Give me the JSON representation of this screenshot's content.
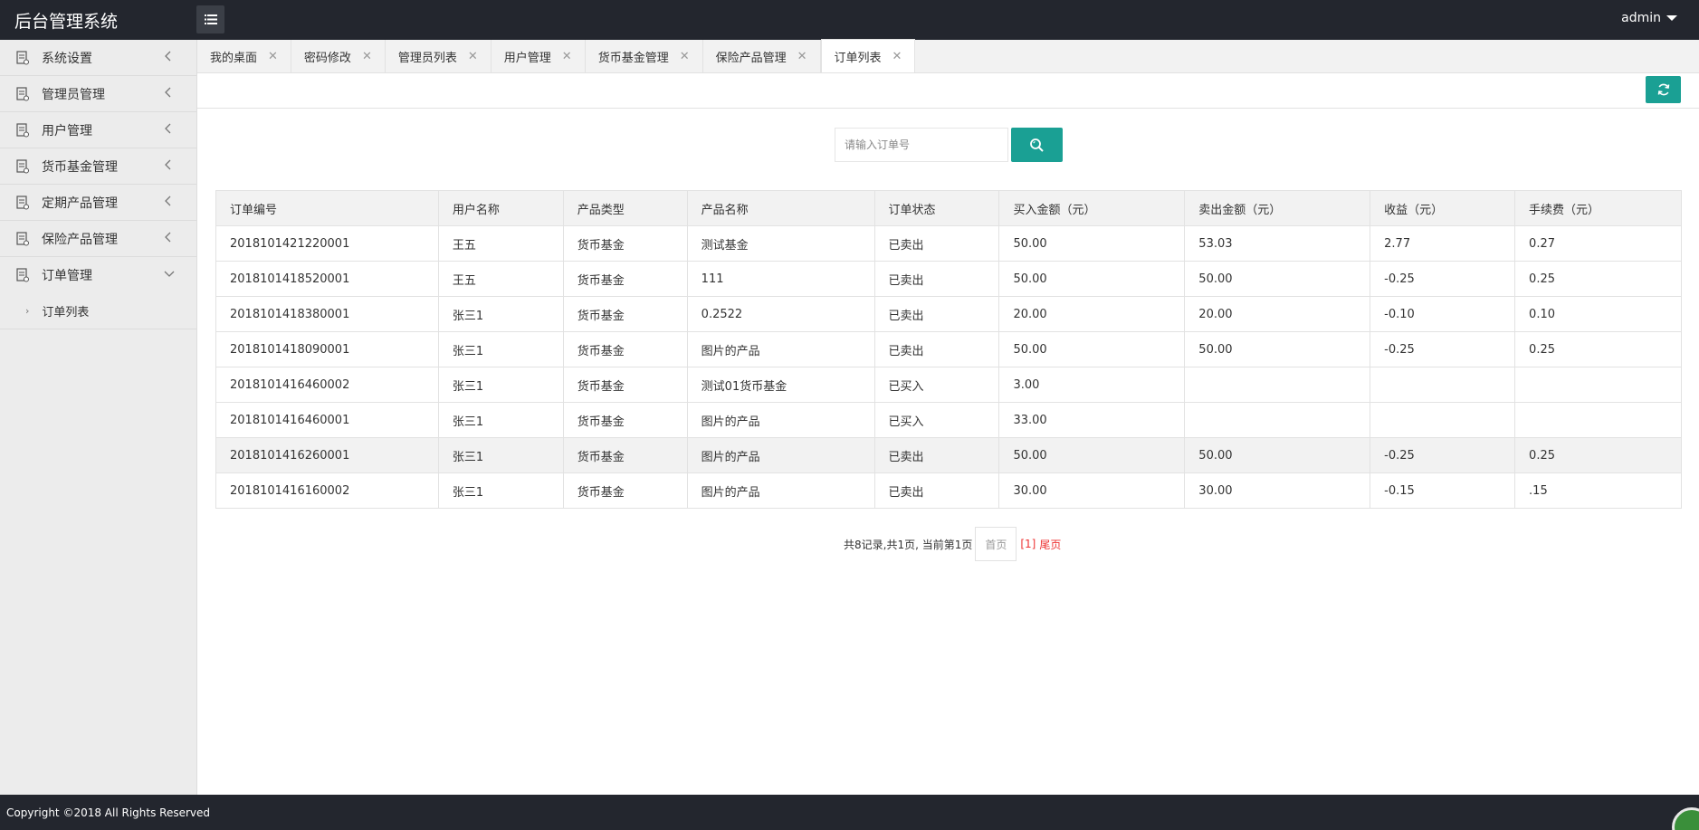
{
  "app": {
    "title": "后台管理系统",
    "user": "admin"
  },
  "sidebar": {
    "items": [
      {
        "label": "系统设置"
      },
      {
        "label": "管理员管理"
      },
      {
        "label": "用户管理"
      },
      {
        "label": "货币基金管理"
      },
      {
        "label": "定期产品管理"
      },
      {
        "label": "保险产品管理"
      },
      {
        "label": "订单管理"
      }
    ],
    "sub_items": [
      {
        "label": "订单列表"
      }
    ]
  },
  "tabs": [
    {
      "label": "我的桌面"
    },
    {
      "label": "密码修改"
    },
    {
      "label": "管理员列表"
    },
    {
      "label": "用户管理"
    },
    {
      "label": "货币基金管理"
    },
    {
      "label": "保险产品管理"
    },
    {
      "label": "订单列表",
      "active": true
    }
  ],
  "search": {
    "placeholder": "请输入订单号",
    "value": ""
  },
  "table": {
    "headers": [
      "订单编号",
      "用户名称",
      "产品类型",
      "产品名称",
      "订单状态",
      "买入金额（元）",
      "卖出金额（元）",
      "收益（元）",
      "手续费（元）"
    ],
    "rows": [
      [
        "2018101421220001",
        "王五",
        "货币基金",
        "测试基金",
        "已卖出",
        "50.00",
        "53.03",
        "2.77",
        "0.27"
      ],
      [
        "2018101418520001",
        "王五",
        "货币基金",
        "111",
        "已卖出",
        "50.00",
        "50.00",
        "-0.25",
        "0.25"
      ],
      [
        "2018101418380001",
        "张三1",
        "货币基金",
        "0.2522",
        "已卖出",
        "20.00",
        "20.00",
        "-0.10",
        "0.10"
      ],
      [
        "2018101418090001",
        "张三1",
        "货币基金",
        "图片的产品",
        "已卖出",
        "50.00",
        "50.00",
        "-0.25",
        "0.25"
      ],
      [
        "2018101416460002",
        "张三1",
        "货币基金",
        "测试01货币基金",
        "已买入",
        "3.00",
        "",
        "",
        ""
      ],
      [
        "2018101416460001",
        "张三1",
        "货币基金",
        "图片的产品",
        "已买入",
        "33.00",
        "",
        "",
        ""
      ],
      [
        "2018101416260001",
        "张三1",
        "货币基金",
        "图片的产品",
        "已卖出",
        "50.00",
        "50.00",
        "-0.25",
        "0.25"
      ],
      [
        "2018101416160002",
        "张三1",
        "货币基金",
        "图片的产品",
        "已卖出",
        "30.00",
        "30.00",
        "-0.15",
        ".15"
      ]
    ],
    "highlighted_row": 6
  },
  "pagination": {
    "summary": "共8记录,共1页, 当前第1页",
    "first_label": "首页",
    "current_label": "[1]",
    "last_label": "尾页"
  },
  "footer": {
    "copyright": "Copyright ©2018 All Rights Reserved"
  },
  "colors": {
    "header_bg": "#23262e",
    "accent": "#1aa094",
    "sidebar_bg": "#ececec",
    "pager_active": "#e33333"
  }
}
